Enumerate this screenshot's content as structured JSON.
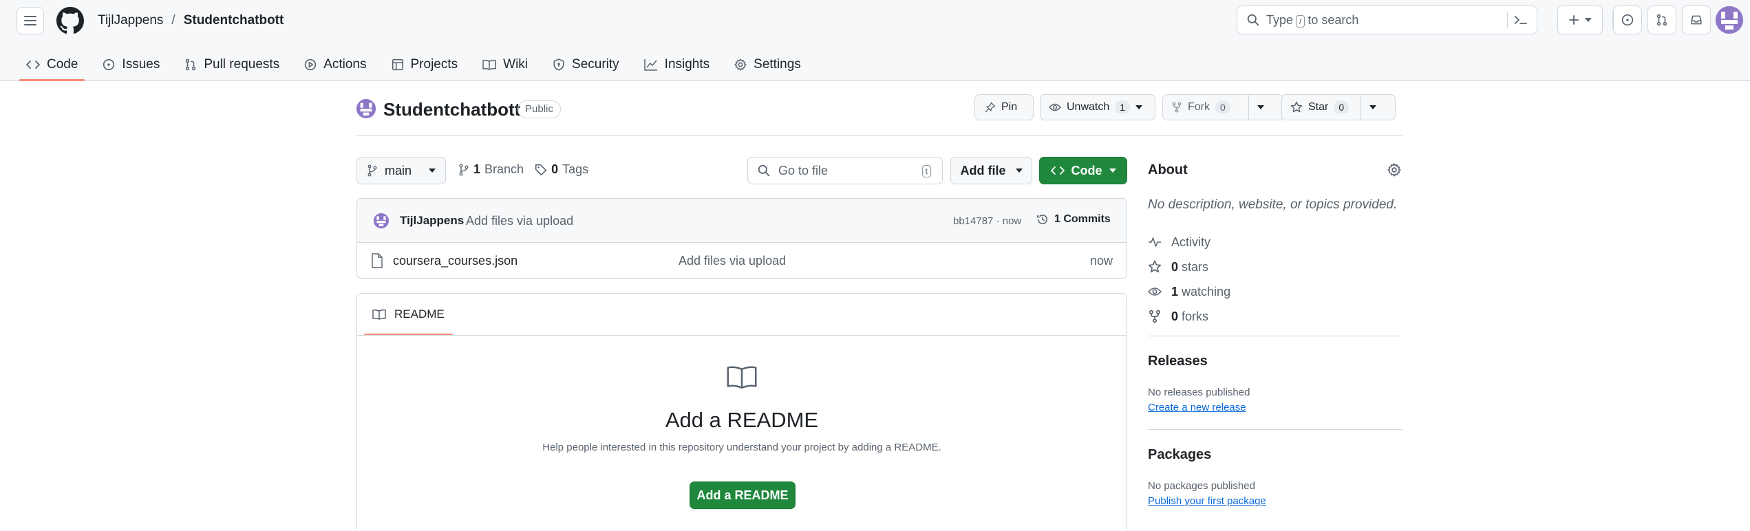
{
  "header": {
    "owner": "TijlJappens",
    "separator": "/",
    "repo": "Studentchatbott",
    "search": {
      "prefix": "Type",
      "key": "/",
      "suffix": "to search"
    }
  },
  "repo_nav": {
    "tabs": [
      {
        "label": "Code",
        "icon": "code-icon",
        "active": true
      },
      {
        "label": "Issues",
        "icon": "issue-icon"
      },
      {
        "label": "Pull requests",
        "icon": "pull-request-icon"
      },
      {
        "label": "Actions",
        "icon": "actions-icon"
      },
      {
        "label": "Projects",
        "icon": "projects-icon"
      },
      {
        "label": "Wiki",
        "icon": "book-icon"
      },
      {
        "label": "Security",
        "icon": "shield-icon"
      },
      {
        "label": "Insights",
        "icon": "graph-icon"
      },
      {
        "label": "Settings",
        "icon": "gear-icon"
      }
    ]
  },
  "repo": {
    "name": "Studentchatbott",
    "visibility": "Public",
    "pin_label": "Pin",
    "watch_label": "Unwatch",
    "watch_count": "1",
    "fork_label": "Fork",
    "fork_count": "0",
    "star_label": "Star",
    "star_count": "0"
  },
  "toolbar": {
    "branch": "main",
    "branch_count": "1",
    "branch_label": "Branch",
    "tag_count": "0",
    "tag_label": "Tags",
    "goto_placeholder": "Go to file",
    "goto_key": "t",
    "add_file_label": "Add file",
    "code_label": "Code"
  },
  "latest_commit": {
    "author": "TijlJappens",
    "message": "Add files via upload",
    "sha_time": "bb14787 · now",
    "commits_label": "1 Commits"
  },
  "files": [
    {
      "name": "coursera_courses.json",
      "message": "Add files via upload",
      "time": "now"
    }
  ],
  "readme": {
    "tab_label": "README",
    "title": "Add a README",
    "subtitle": "Help people interested in this repository understand your project by adding a README.",
    "button": "Add a README"
  },
  "about": {
    "title": "About",
    "description": "No description, website, or topics provided.",
    "items": [
      {
        "icon": "pulse-icon",
        "count": "",
        "label": "Activity"
      },
      {
        "icon": "star-icon",
        "count": "0",
        "label": "stars"
      },
      {
        "icon": "eye-icon",
        "count": "1",
        "label": "watching"
      },
      {
        "icon": "fork-icon",
        "count": "0",
        "label": "forks"
      }
    ]
  },
  "releases": {
    "title": "Releases",
    "text": "No releases published",
    "link": "Create a new release"
  },
  "packages": {
    "title": "Packages",
    "text": "No packages published",
    "link": "Publish your first package"
  },
  "colors": {
    "accent_underline": "#fd8c73",
    "primary_green": "#1f883d",
    "link_blue": "#0969da",
    "avatar_purple": "#8f77c8"
  }
}
